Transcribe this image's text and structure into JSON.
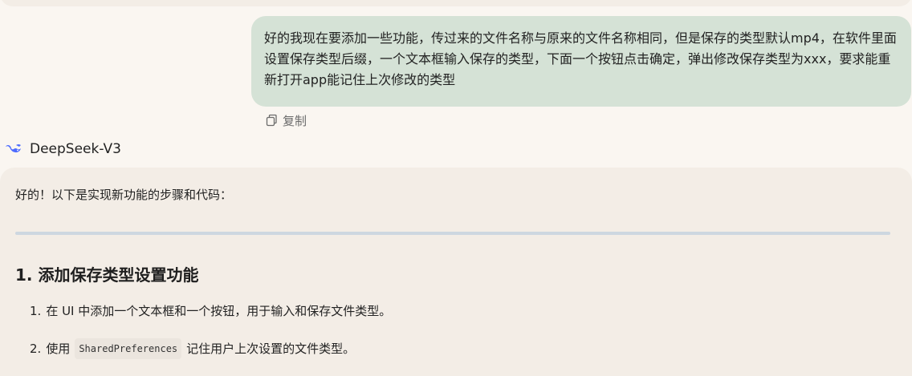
{
  "conversation": {
    "user_message": {
      "text": "好的我现在要添加一些功能，传过来的文件名称与原来的文件名称相同，但是保存的类型默认mp4，在软件里面设置保存类型后缀，一个文本框输入保存的类型，下面一个按钮点击确定，弹出修改保存类型为xxx，要求能重新打开app能记住上次修改的类型",
      "copy_label": "复制"
    },
    "assistant": {
      "model_name": "DeepSeek-V3",
      "intro": "好的！以下是实现新功能的步骤和代码：",
      "section_heading": "1. 添加保存类型设置功能",
      "steps": [
        {
          "number": "1.",
          "text": "在 UI 中添加一个文本框和一个按钮，用于输入和保存文件类型。"
        },
        {
          "number": "2.",
          "before": "使用",
          "code": "SharedPreferences",
          "after": "记住用户上次设置的文件类型。"
        }
      ]
    }
  },
  "icons": {
    "copy": "copy-icon",
    "model_logo": "deepseek-whale-icon"
  },
  "colors": {
    "background": "#faf6f1",
    "user_bubble": "#d5e2d6",
    "answer_card": "#f3ede6",
    "model_logo": "#4d6bfe",
    "divider": "#cdd7e0"
  }
}
